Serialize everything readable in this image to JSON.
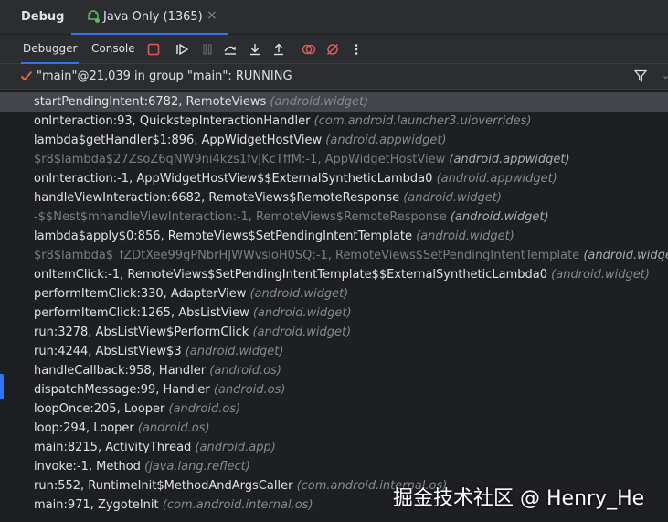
{
  "window": {
    "title": "Debug",
    "session_tab": {
      "label": "Java Only (1365)",
      "close": "×"
    }
  },
  "toolbar": {
    "tabs": [
      {
        "label": "Debugger",
        "active": true
      },
      {
        "label": "Console",
        "active": false
      }
    ],
    "buttons": [
      {
        "name": "stop-icon",
        "color": "#db5c5c"
      },
      {
        "name": "resume-icon",
        "color": "#dfe1e5"
      },
      {
        "name": "pause-icon",
        "color": "#5e6064"
      },
      {
        "name": "step-over-icon",
        "color": "#dfe1e5"
      },
      {
        "name": "step-into-icon",
        "color": "#dfe1e5"
      },
      {
        "name": "step-out-icon",
        "color": "#dfe1e5"
      },
      {
        "name": "view-breakpoints-icon",
        "color": "#db5c5c"
      },
      {
        "name": "mute-breakpoints-icon",
        "color": "#db5c5c"
      },
      {
        "name": "more-vertical-icon",
        "color": "#dfe1e5"
      }
    ]
  },
  "thread": {
    "label": "\"main\"@21,039 in group \"main\": RUNNING",
    "check_color": "#e0693d"
  },
  "frames": [
    {
      "fn": "startPendingIntent:6782, RemoteViews",
      "pkg": "(android.widget)",
      "dim": false,
      "selected": true
    },
    {
      "fn": "onInteraction:93, QuickstepInteractionHandler",
      "pkg": "(com.android.launcher3.uioverrides)",
      "dim": false
    },
    {
      "fn": "lambda$getHandler$1:896, AppWidgetHostView",
      "pkg": "(android.appwidget)",
      "dim": false
    },
    {
      "fn": "$r8$lambda$27ZsoZ6qNW9ni4kzs1fvJKcTffM:-1, AppWidgetHostView",
      "pkg": "(android.appwidget)",
      "dim": true
    },
    {
      "fn": "onInteraction:-1, AppWidgetHostView$$ExternalSyntheticLambda0",
      "pkg": "(android.appwidget)",
      "dim": false
    },
    {
      "fn": "handleViewInteraction:6682, RemoteViews$RemoteResponse",
      "pkg": "(android.widget)",
      "dim": false
    },
    {
      "fn": "-$$Nest$mhandleViewInteraction:-1, RemoteViews$RemoteResponse",
      "pkg": "(android.widget)",
      "dim": true
    },
    {
      "fn": "lambda$apply$0:856, RemoteViews$SetPendingIntentTemplate",
      "pkg": "(android.widget)",
      "dim": false
    },
    {
      "fn": "$r8$lambda$_fZDtXee99gPNbrHJWWvsioH0SQ:-1, RemoteViews$SetPendingIntentTemplate",
      "pkg": "(android.widget)",
      "dim": true
    },
    {
      "fn": "onItemClick:-1, RemoteViews$SetPendingIntentTemplate$$ExternalSyntheticLambda0",
      "pkg": "(android.widget)",
      "dim": false
    },
    {
      "fn": "performItemClick:330, AdapterView",
      "pkg": "(android.widget)",
      "dim": false
    },
    {
      "fn": "performItemClick:1265, AbsListView",
      "pkg": "(android.widget)",
      "dim": false
    },
    {
      "fn": "run:3278, AbsListView$PerformClick",
      "pkg": "(android.widget)",
      "dim": false
    },
    {
      "fn": "run:4244, AbsListView$3",
      "pkg": "(android.widget)",
      "dim": false
    },
    {
      "fn": "handleCallback:958, Handler",
      "pkg": "(android.os)",
      "dim": false
    },
    {
      "fn": "dispatchMessage:99, Handler",
      "pkg": "(android.os)",
      "dim": false
    },
    {
      "fn": "loopOnce:205, Looper",
      "pkg": "(android.os)",
      "dim": false
    },
    {
      "fn": "loop:294, Looper",
      "pkg": "(android.os)",
      "dim": false
    },
    {
      "fn": "main:8215, ActivityThread",
      "pkg": "(android.app)",
      "dim": false
    },
    {
      "fn": "invoke:-1, Method",
      "pkg": "(java.lang.reflect)",
      "dim": false
    },
    {
      "fn": "run:552, RuntimeInit$MethodAndArgsCaller",
      "pkg": "(com.android.internal.os)",
      "dim": false
    },
    {
      "fn": "main:971, ZygoteInit",
      "pkg": "(com.android.internal.os)",
      "dim": false
    }
  ],
  "watermark": "掘金技术社区 @ Henry_He"
}
